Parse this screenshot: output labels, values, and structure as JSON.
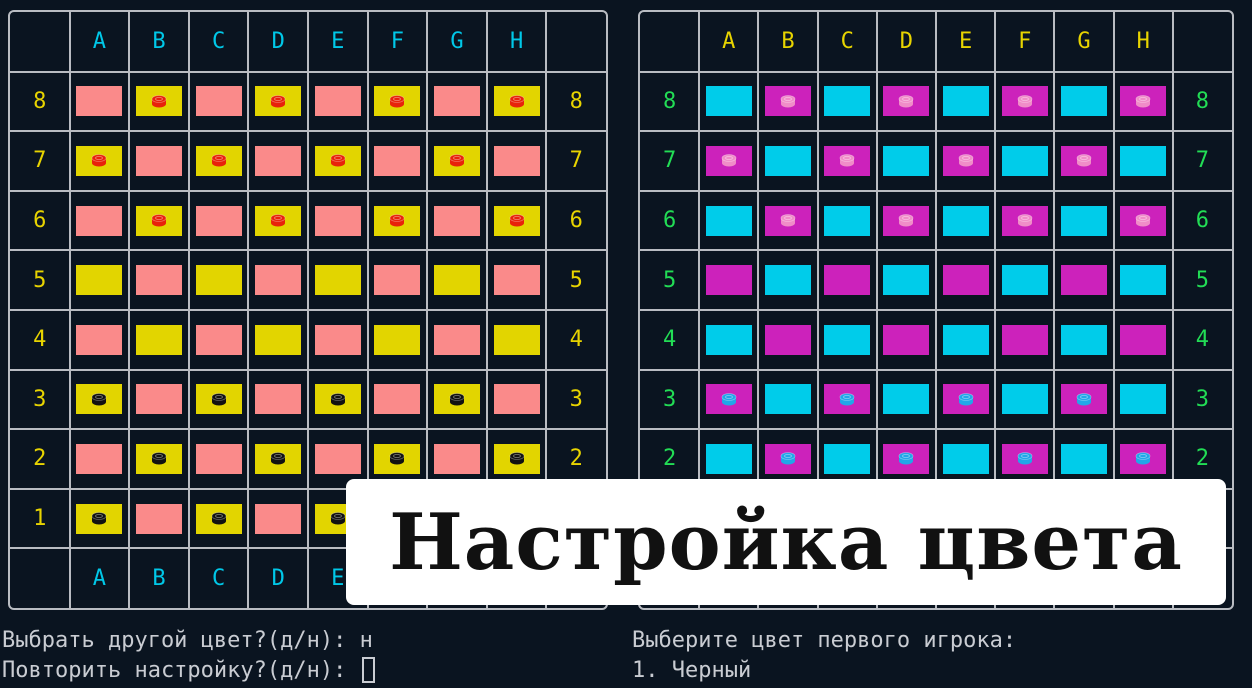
{
  "columns": [
    "A",
    "B",
    "C",
    "D",
    "E",
    "F",
    "G",
    "H"
  ],
  "rows": [
    "8",
    "7",
    "6",
    "5",
    "4",
    "3",
    "2",
    "1"
  ],
  "pieces_top": [
    "8",
    "7",
    "6"
  ],
  "pieces_bottom": [
    "3",
    "2",
    "1"
  ],
  "board_left": {
    "label_color": "#e8d400",
    "col_label_color": "#00c8e8",
    "dark_square": "#e2d500",
    "light_square": "#fa8a8a",
    "top_piece": "#e8220a",
    "bottom_piece": "#111111"
  },
  "board_right": {
    "label_color": "#22dd55",
    "col_label_color": "#e8d400",
    "dark_square": "#cc22bb",
    "light_square": "#00ccea",
    "top_piece": "#f08cc8",
    "bottom_piece": "#22a6e8"
  },
  "banner": {
    "title": "Настройка цвета"
  },
  "terminal_left": {
    "line1": "Выбрать другой цвет?(д/н): н",
    "line2": "Повторить настройку?(д/н): "
  },
  "terminal_right": {
    "line1": "Выберите цвет первого игрока:",
    "line2": "1. Черный"
  },
  "icons": {
    "piece": "checker-piece-icon"
  }
}
